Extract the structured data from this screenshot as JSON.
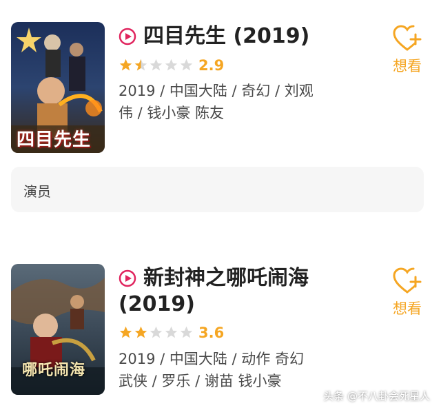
{
  "items": [
    {
      "title_line1": "四目先生 (2019)",
      "title_line2": "",
      "rating": 2.9,
      "rating_stars": 1.5,
      "score_text": "2.9",
      "meta_line1": "2019 / 中国大陆 / 奇幻 / 刘观",
      "meta_line2": "伟 / 钱小豪 陈友",
      "poster_text": "四目先生",
      "want_label": "想看"
    },
    {
      "title_line1": "新封神之哪吒闹海",
      "title_line2": "(2019)",
      "rating": 3.6,
      "rating_stars": 2,
      "score_text": "3.6",
      "meta_line1": "2019 / 中国大陆 / 动作 奇幻",
      "meta_line2": "武侠 / 罗乐 / 谢苗 钱小豪",
      "poster_text": "哪吒闹海",
      "want_label": "想看"
    }
  ],
  "actor_card": {
    "label": "演员"
  },
  "watermark": "头条 @不八卦会死星人",
  "colors": {
    "accent": "#f5a623",
    "play": "#e0245e",
    "star_empty": "#d9d9d9"
  }
}
